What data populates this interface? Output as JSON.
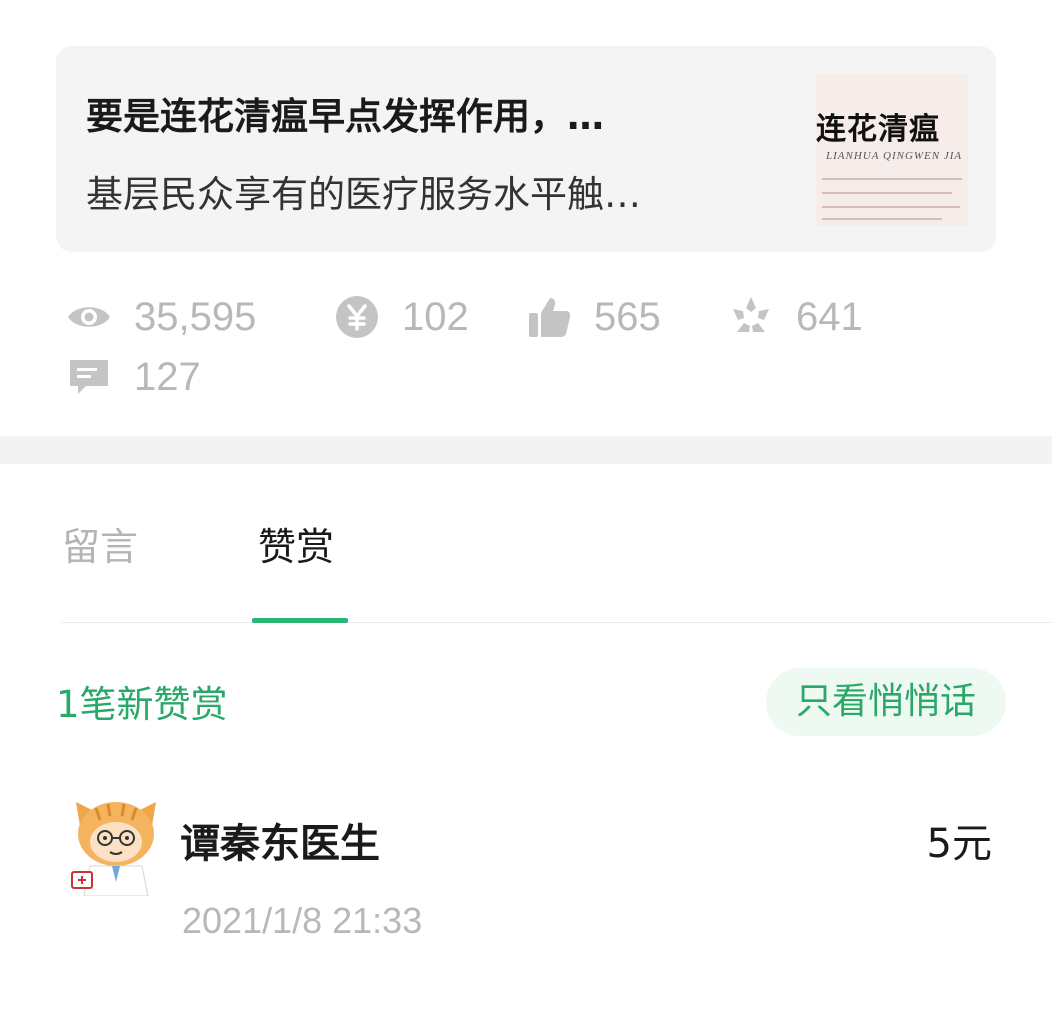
{
  "article": {
    "title": "要是连花清瘟早点发挥作用，…",
    "summary": "基层民众享有的医疗服务水平触…",
    "thumbnail": {
      "title": "连花清瘟",
      "subtitle": "LIANHUA QINGWEN JIA"
    }
  },
  "stats": {
    "views": "35,595",
    "rewards": "102",
    "likes": "565",
    "shares": "641",
    "comments": "127"
  },
  "tabs": {
    "comments_label": "留言",
    "reward_label": "赞赏",
    "active": "赞赏"
  },
  "reward_list": {
    "count_text": "1笔新赞赏",
    "filter_label": "只看悄悄话",
    "items": [
      {
        "name": "谭秦东医生",
        "time": "2021/1/8 21:33",
        "amount": "5元"
      }
    ]
  },
  "colors": {
    "accent": "#2bb673",
    "accent_text": "#2aa86a",
    "muted": "#b8b8b8",
    "card_bg": "#f4f4f4"
  },
  "icons": [
    "eye-icon",
    "yuan-coin-icon",
    "thumbs-up-icon",
    "share-sparkle-icon",
    "comment-bubble-icon"
  ]
}
